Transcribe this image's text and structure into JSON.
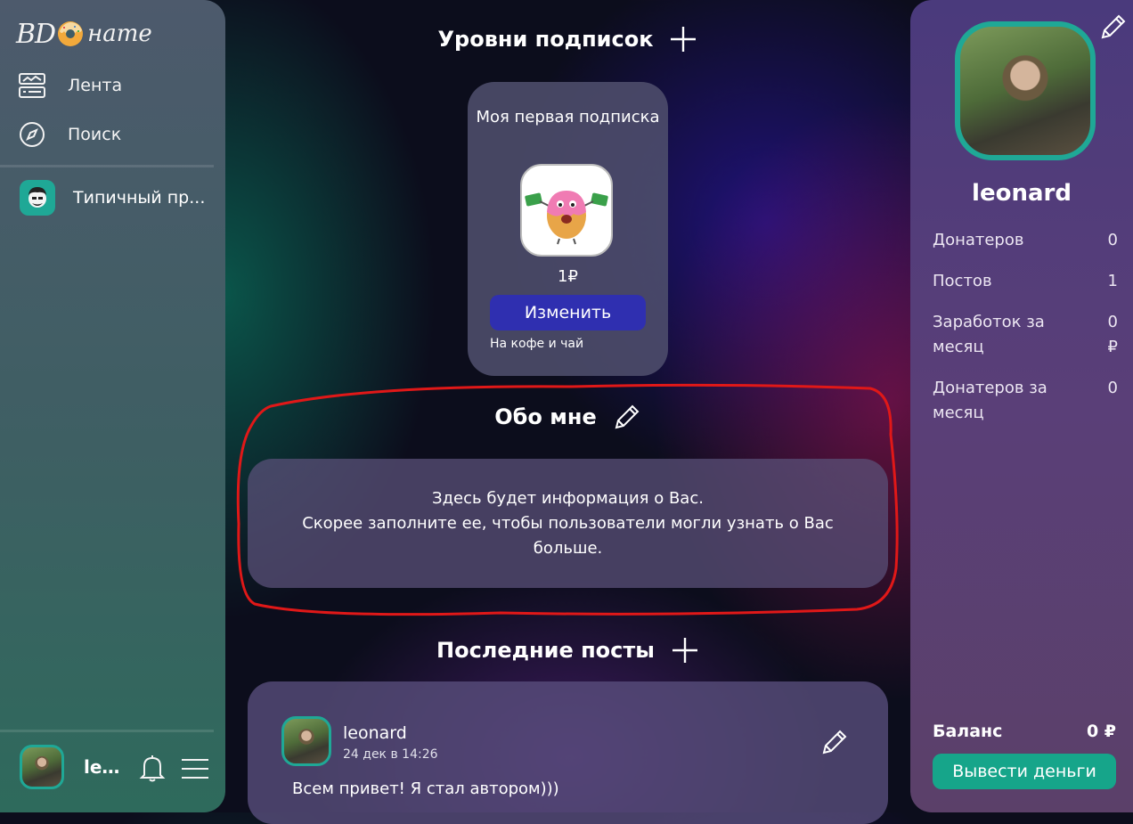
{
  "sidebar": {
    "logo": {
      "part1": "BD",
      "part2": "нате",
      "icon": "donut-icon"
    },
    "nav": [
      {
        "label": "Лента",
        "icon": "feed-icon"
      },
      {
        "label": "Поиск",
        "icon": "compass-icon"
      }
    ],
    "subscriptions": [
      {
        "label": "Типичный пр...",
        "icon": "subscription-avatar"
      }
    ],
    "user": {
      "name": "leonard",
      "display": "leo..."
    },
    "icons": {
      "bell": "bell-icon",
      "menu": "menu-icon"
    }
  },
  "main": {
    "tiers_title": "Уровни подписок",
    "tier": {
      "title": "Моя первая подписка",
      "price": "1₽",
      "button": "Изменить",
      "description": "На кофе и чай"
    },
    "about_title": "Обо мне",
    "about_text_line1": "Здесь будет информация о Вас.",
    "about_text_line2": "Скорее заполните ее, чтобы пользователи могли узнать о Вас больше.",
    "posts_title": "Последние посты",
    "post": {
      "author": "leonard",
      "date": "24 дек в 14:26",
      "text": "Всем привет! Я стал автором)))"
    }
  },
  "profile": {
    "name": "leonard",
    "stats": [
      {
        "label": "Донатеров",
        "value": "0"
      },
      {
        "label": "Постов",
        "value": "1"
      },
      {
        "label": "Заработок за месяц",
        "value": "0 ₽"
      },
      {
        "label": "Донатеров за месяц",
        "value": "0"
      }
    ],
    "balance_label": "Баланс",
    "balance_value": "0 ₽",
    "withdraw_button": "Вывести деньги"
  },
  "colors": {
    "accent_teal": "#1fa896",
    "button_blue": "#2f2fb0",
    "button_green": "#16a58a",
    "annotation_red": "#e01818"
  }
}
